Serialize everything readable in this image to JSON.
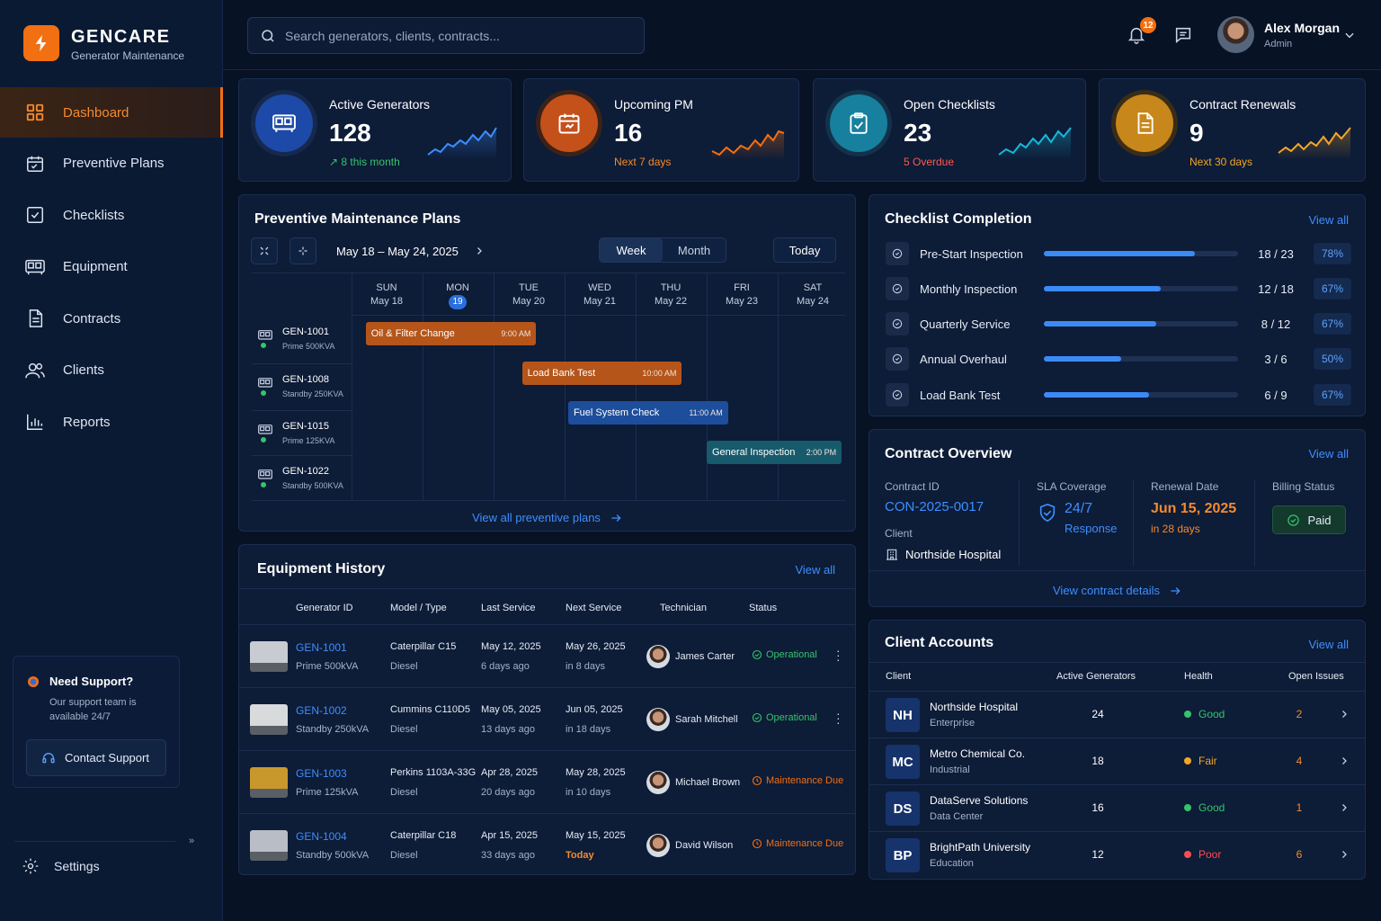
{
  "brand": {
    "name": "GENCARE",
    "subtitle": "Generator Maintenance"
  },
  "nav": [
    {
      "label": "Dashboard",
      "icon": "dashboard-icon",
      "active": true
    },
    {
      "label": "Preventive Plans",
      "icon": "calendar-icon"
    },
    {
      "label": "Checklists",
      "icon": "checkbox-icon"
    },
    {
      "label": "Equipment",
      "icon": "generator-icon"
    },
    {
      "label": "Contracts",
      "icon": "document-icon"
    },
    {
      "label": "Clients",
      "icon": "users-icon"
    },
    {
      "label": "Reports",
      "icon": "bar-chart-icon"
    }
  ],
  "support": {
    "title": "Need Support?",
    "text": "Our support team is available 24/7",
    "button": "Contact Support"
  },
  "settings_label": "Settings",
  "search": {
    "placeholder": "Search generators, clients, contracts..."
  },
  "notifications": {
    "count": "12"
  },
  "user": {
    "name": "Alex Morgan",
    "role": "Admin"
  },
  "colors": {
    "accent": "#f26f12",
    "primary": "#3e8eff",
    "success": "#35c46a",
    "warning": "#f5a524",
    "danger": "#ff4d4f"
  },
  "kpis": [
    {
      "title": "Active Generators",
      "value": "128",
      "sub": "8 this month",
      "sub_arrow": "↗",
      "color": "#2d6be0"
    },
    {
      "title": "Upcoming PM",
      "value": "16",
      "sub": "Next 7 days",
      "color": "#e2661c"
    },
    {
      "title": "Open Checklists",
      "value": "23",
      "sub": "5 Overdue",
      "color": "#1a8fb0"
    },
    {
      "title": "Contract Renewals",
      "value": "9",
      "sub": "Next 30 days",
      "color": "#d8971a"
    }
  ],
  "pm": {
    "title": "Preventive Maintenance Plans",
    "date_range": "May 18 – May 24, 2025",
    "view_week": "Week",
    "view_month": "Month",
    "today": "Today",
    "days": [
      {
        "dow": "SUN",
        "date": "May 18"
      },
      {
        "dow": "MON",
        "date": "19",
        "today": true
      },
      {
        "dow": "TUE",
        "date": "May 20"
      },
      {
        "dow": "WED",
        "date": "May 21"
      },
      {
        "dow": "THU",
        "date": "May 22"
      },
      {
        "dow": "FRI",
        "date": "May 23"
      },
      {
        "dow": "SAT",
        "date": "May 24"
      }
    ],
    "generators": [
      {
        "id": "GEN-1001",
        "model": "Prime 500KVA"
      },
      {
        "id": "GEN-1008",
        "model": "Standby 250KVA"
      },
      {
        "id": "GEN-1015",
        "model": "Prime 125KVA"
      },
      {
        "id": "GEN-1022",
        "model": "Standby 500KVA"
      }
    ],
    "tasks": [
      {
        "name": "Oil & Filter Change",
        "time": "9:00 AM",
        "row": 0,
        "start_day": 0.2,
        "span_days": 2.4,
        "color": "#b5551a"
      },
      {
        "name": "Load Bank Test",
        "time": "10:00 AM",
        "row": 1,
        "start_day": 2.4,
        "span_days": 2.25,
        "color": "#b5551a"
      },
      {
        "name": "Fuel System Check",
        "time": "11:00 AM",
        "row": 2,
        "start_day": 3.05,
        "span_days": 2.25,
        "color": "#1d4e9c"
      },
      {
        "name": "General Inspection",
        "time": "2:00 PM",
        "row": 3,
        "start_day": 5.0,
        "span_days": 1.9,
        "color": "#165a6c"
      }
    ],
    "view_all": "View all preventive plans"
  },
  "checklist": {
    "title": "Checklist Completion",
    "view_all": "View all",
    "items": [
      {
        "name": "Pre-Start Inspection",
        "count": "18 / 23",
        "pct": "78%",
        "progress": 0.78
      },
      {
        "name": "Monthly Inspection",
        "count": "12 / 18",
        "pct": "67%",
        "progress": 0.6
      },
      {
        "name": "Quarterly Service",
        "count": "8 / 12",
        "pct": "67%",
        "progress": 0.58
      },
      {
        "name": "Annual Overhaul",
        "count": "3 / 6",
        "pct": "50%",
        "progress": 0.4
      },
      {
        "name": "Load Bank Test",
        "count": "6 / 9",
        "pct": "67%",
        "progress": 0.54
      }
    ]
  },
  "contract": {
    "title": "Contract Overview",
    "view_all": "View all",
    "id_label": "Contract ID",
    "id": "CON-2025-0017",
    "client_label": "Client",
    "client": "Northside Hospital",
    "sla_label": "SLA Coverage",
    "sla": "24/7",
    "sla_sub": "Response",
    "renewal_label": "Renewal Date",
    "renewal": "Jun 15, 2025",
    "renewal_sub": "in 28 days",
    "billing_label": "Billing Status",
    "billing": "Paid",
    "details": "View contract details"
  },
  "equipment": {
    "title": "Equipment History",
    "view_all": "View all",
    "headers": [
      "Generator ID",
      "Model / Type",
      "Last Service",
      "Next Service",
      "Technician",
      "Status"
    ],
    "rows": [
      {
        "id": "GEN-1001",
        "rating": "Prime 500kVA",
        "model": "Caterpillar C15",
        "fuel": "Diesel",
        "last": "May 12, 2025",
        "last_ago": "6 days ago",
        "next": "May 26, 2025",
        "next_in": "in 8 days",
        "tech": "James Carter",
        "status": "Operational",
        "status_color": "#35c46a",
        "thumb": "#c8ccd2"
      },
      {
        "id": "GEN-1002",
        "rating": "Standby 250kVA",
        "model": "Cummins C110D5",
        "fuel": "Diesel",
        "last": "May 05, 2025",
        "last_ago": "13 days ago",
        "next": "Jun 05, 2025",
        "next_in": "in 18 days",
        "tech": "Sarah Mitchell",
        "status": "Operational",
        "status_color": "#35c46a",
        "thumb": "#d8dadc"
      },
      {
        "id": "GEN-1003",
        "rating": "Prime 125kVA",
        "model": "Perkins 1103A-33G",
        "fuel": "Diesel",
        "last": "Apr 28, 2025",
        "last_ago": "20 days ago",
        "next": "May 28, 2025",
        "next_in": "in 10 days",
        "tech": "Michael Brown",
        "status": "Maintenance Due",
        "status_color": "#f26f12",
        "thumb": "#c8982c"
      },
      {
        "id": "GEN-1004",
        "rating": "Standby 500kVA",
        "model": "Caterpillar C18",
        "fuel": "Diesel",
        "last": "Apr 15, 2025",
        "last_ago": "33 days ago",
        "next": "May 15, 2025",
        "next_in": "Today",
        "tech": "David Wilson",
        "status": "Maintenance Due",
        "status_color": "#f26f12",
        "thumb": "#b9bec6"
      }
    ]
  },
  "clients": {
    "title": "Client Accounts",
    "view_all": "View all",
    "headers": [
      "Client",
      "Active Generators",
      "Health",
      "Open Issues"
    ],
    "rows": [
      {
        "initials": "NH",
        "name": "Northside Hospital",
        "type": "Enterprise",
        "gens": "24",
        "health": "Good",
        "health_color": "#35c46a",
        "issues": "2"
      },
      {
        "initials": "MC",
        "name": "Metro Chemical Co.",
        "type": "Industrial",
        "gens": "18",
        "health": "Fair",
        "health_color": "#f5a524",
        "issues": "4"
      },
      {
        "initials": "DS",
        "name": "DataServe Solutions",
        "type": "Data Center",
        "gens": "16",
        "health": "Good",
        "health_color": "#35c46a",
        "issues": "1"
      },
      {
        "initials": "BP",
        "name": "BrightPath University",
        "type": "Education",
        "gens": "12",
        "health": "Poor",
        "health_color": "#ff4d4f",
        "issues": "6"
      }
    ]
  }
}
